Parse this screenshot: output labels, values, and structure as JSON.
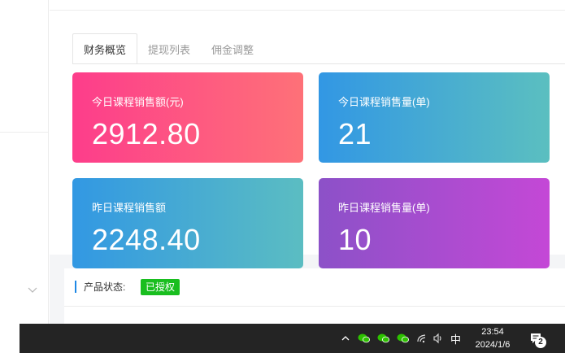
{
  "tabs": [
    {
      "label": "财务概览",
      "active": true
    },
    {
      "label": "提现列表",
      "active": false
    },
    {
      "label": "佣金调整",
      "active": false
    }
  ],
  "stats": [
    {
      "label": "今日课程销售额(元)",
      "value": "2912.80",
      "gradient": [
        "#fd3d8b",
        "#fe7178"
      ]
    },
    {
      "label": "今日课程销售量(单)",
      "value": "21",
      "gradient": [
        "#3297e4",
        "#5bbfc0"
      ]
    },
    {
      "label": "昨日课程销售额",
      "value": "2248.40",
      "gradient": [
        "#3298e3",
        "#5bbdc2"
      ]
    },
    {
      "label": "昨日课程销售量(单)",
      "value": "10",
      "gradient": [
        "#8c51c8",
        "#c448d6"
      ]
    }
  ],
  "product_status": {
    "label": "产品状态:",
    "badge": "已授权",
    "badge_color": "#19be1f"
  },
  "taskbar": {
    "ime": "中",
    "time": "23:54",
    "date": "2024/1/6",
    "notification_count": "2",
    "tray_icons": [
      "chevron-up-icon",
      "wechat-icon",
      "wechat-icon",
      "wechat-icon",
      "wifi-icon",
      "speaker-icon"
    ]
  }
}
